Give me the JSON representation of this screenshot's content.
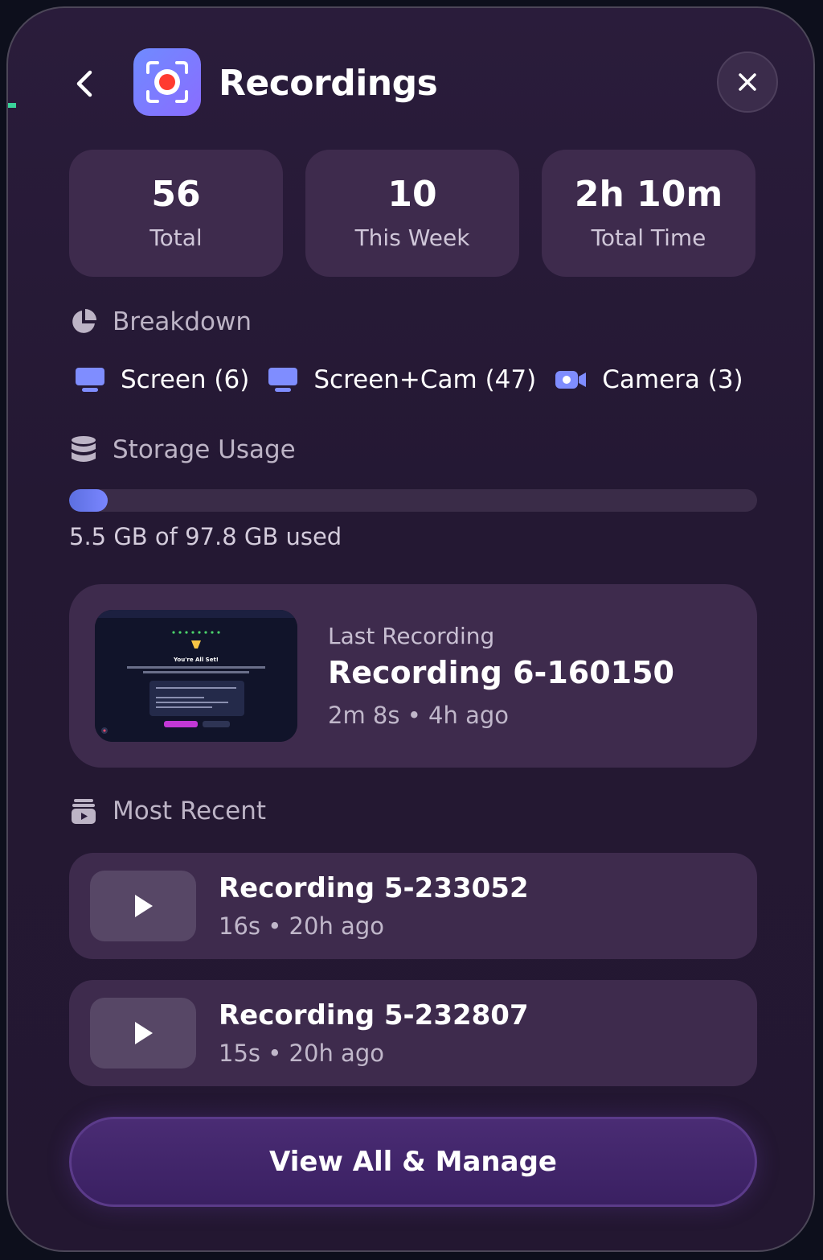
{
  "header": {
    "title": "Recordings",
    "back_icon": "chevron-left-icon",
    "app_icon": "record-icon",
    "close_icon": "close-icon"
  },
  "stats": [
    {
      "value": "56",
      "label": "Total"
    },
    {
      "value": "10",
      "label": "This Week"
    },
    {
      "value": "2h 10m",
      "label": "Total Time"
    }
  ],
  "breakdown": {
    "title": "Breakdown",
    "icon": "pie-chart-icon",
    "items": [
      {
        "label": "Screen (6)",
        "icon": "monitor-icon"
      },
      {
        "label": "Screen+Cam (47)",
        "icon": "monitor-icon"
      },
      {
        "label": "Camera (3)",
        "icon": "video-camera-icon"
      }
    ]
  },
  "storage": {
    "title": "Storage Usage",
    "icon": "database-icon",
    "used_gb": 5.5,
    "total_gb": 97.8,
    "text": "5.5 GB of 97.8 GB used"
  },
  "last_recording": {
    "label": "Last Recording",
    "name": "Recording 6-160150",
    "meta": "2m 8s • 4h ago",
    "thumbnail": {
      "heading": "You're All Set!"
    }
  },
  "most_recent": {
    "title": "Most Recent",
    "icon": "archive-icon",
    "items": [
      {
        "name": "Recording 5-233052",
        "meta": "16s • 20h ago",
        "icon": "play-icon"
      },
      {
        "name": "Recording 5-232807",
        "meta": "15s • 20h ago",
        "icon": "play-icon"
      }
    ]
  },
  "footer": {
    "button_label": "View All & Manage"
  },
  "colors": {
    "panel_bg": "#241833",
    "card_bg": "#3e2b4d",
    "accent": "#7a86ff",
    "record_red": "#ff3b30"
  }
}
